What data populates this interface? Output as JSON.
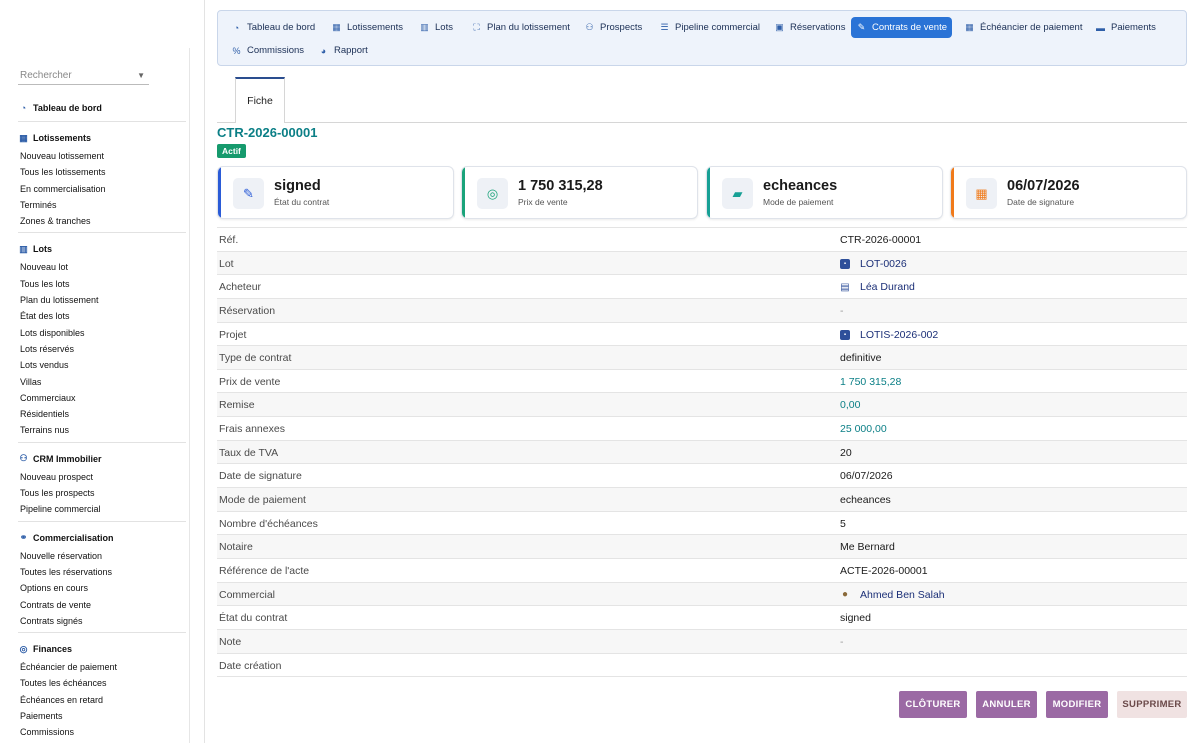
{
  "sidebar": {
    "search_placeholder": "Rechercher",
    "sections": [
      {
        "title": "Tableau de bord",
        "icon": "gauge-icon",
        "items": []
      },
      {
        "title": "Lotissements",
        "icon": "buildings-icon",
        "items": [
          "Nouveau lotissement",
          "Tous les lotissements",
          "En commercialisation",
          "Terminés",
          "Zones & tranches"
        ]
      },
      {
        "title": "Lots",
        "icon": "map-icon",
        "items": [
          "Nouveau lot",
          "Tous les lots",
          "Plan du lotissement",
          "État des lots",
          "Lots disponibles",
          "Lots réservés",
          "Lots vendus",
          "Villas",
          "Commerciaux",
          "Résidentiels",
          "Terrains nus"
        ]
      },
      {
        "title": "CRM Immobilier",
        "icon": "user-plus-icon",
        "items": [
          "Nouveau prospect",
          "Tous les prospects",
          "Pipeline commercial"
        ]
      },
      {
        "title": "Commercialisation",
        "icon": "handshake-icon",
        "items": [
          "Nouvelle réservation",
          "Toutes les réservations",
          "Options en cours",
          "Contrats de vente",
          "Contrats signés"
        ]
      },
      {
        "title": "Finances",
        "icon": "coins-icon",
        "items": [
          "Échéancier de paiement",
          "Toutes les échéances",
          "Échéances en retard",
          "Paiements",
          "Commissions"
        ]
      }
    ]
  },
  "nav": {
    "items": [
      {
        "label": "Tableau de bord",
        "icon": "gauge-icon"
      },
      {
        "label": "Lotissements",
        "icon": "buildings-icon"
      },
      {
        "label": "Lots",
        "icon": "map-icon"
      },
      {
        "label": "Plan du lotissement",
        "icon": "map-marker-icon"
      },
      {
        "label": "Prospects",
        "icon": "user-plus-icon"
      },
      {
        "label": "Pipeline commercial",
        "icon": "list-icon"
      },
      {
        "label": "Réservations",
        "icon": "calendar-check-icon"
      },
      {
        "label": "Contrats de vente",
        "icon": "signature-icon",
        "active": true
      },
      {
        "label": "Échéancier de paiement",
        "icon": "calendar-icon"
      },
      {
        "label": "Paiements",
        "icon": "money-icon"
      },
      {
        "label": "Commissions",
        "icon": "percent-icon"
      },
      {
        "label": "Rapport",
        "icon": "pie-chart-icon"
      }
    ]
  },
  "tab": {
    "label": "Fiche"
  },
  "record": {
    "title": "CTR-2026-00001",
    "status_badge": "Actif"
  },
  "cards": [
    {
      "value": "signed",
      "label": "État du contrat",
      "icon": "signature-icon",
      "color": "#2a5bd7"
    },
    {
      "value": "1 750 315,28",
      "label": "Prix de vente",
      "icon": "coins-icon",
      "color": "#1aa37a"
    },
    {
      "value": "echeances",
      "label": "Mode de paiement",
      "icon": "wallet-icon",
      "color": "#17a095"
    },
    {
      "value": "06/07/2026",
      "label": "Date de signature",
      "icon": "calendar-icon",
      "color": "#f07a1a"
    }
  ],
  "fields": [
    {
      "label": "Réf.",
      "value": "CTR-2026-00001",
      "style": "plain"
    },
    {
      "label": "Lot",
      "value": "LOT-0026",
      "style": "link",
      "icon": "lot-icon"
    },
    {
      "label": "Acheteur",
      "value": "Léa Durand",
      "style": "link",
      "icon": "building-icon"
    },
    {
      "label": "Réservation",
      "value": "-",
      "style": "dash"
    },
    {
      "label": "Projet",
      "value": "LOTIS-2026-002",
      "style": "link",
      "icon": "project-icon"
    },
    {
      "label": "Type de contrat",
      "value": "definitive",
      "style": "plain"
    },
    {
      "label": "Prix de vente",
      "value": "1 750 315,28",
      "style": "money"
    },
    {
      "label": "Remise",
      "value": "0,00",
      "style": "money"
    },
    {
      "label": "Frais annexes",
      "value": "25 000,00",
      "style": "money"
    },
    {
      "label": "Taux de TVA",
      "value": "20",
      "style": "plain"
    },
    {
      "label": "Date de signature",
      "value": "06/07/2026",
      "style": "plain"
    },
    {
      "label": "Mode de paiement",
      "value": "echeances",
      "style": "plain"
    },
    {
      "label": "Nombre d'échéances",
      "value": "5",
      "style": "plain"
    },
    {
      "label": "Notaire",
      "value": "Me Bernard",
      "style": "plain"
    },
    {
      "label": "Référence de l'acte",
      "value": "ACTE-2026-00001",
      "style": "plain"
    },
    {
      "label": "Commercial",
      "value": "Ahmed Ben Salah",
      "style": "link",
      "icon": "user-icon"
    },
    {
      "label": "État du contrat",
      "value": "signed",
      "style": "plain"
    },
    {
      "label": "Note",
      "value": "-",
      "style": "dash"
    },
    {
      "label": "Date création",
      "value": "",
      "style": "plain"
    }
  ],
  "actions": {
    "close_label": "CLÔTURER",
    "cancel_label": "ANNULER",
    "edit_label": "MODIFIER",
    "delete_label": "SUPPRIMER"
  }
}
